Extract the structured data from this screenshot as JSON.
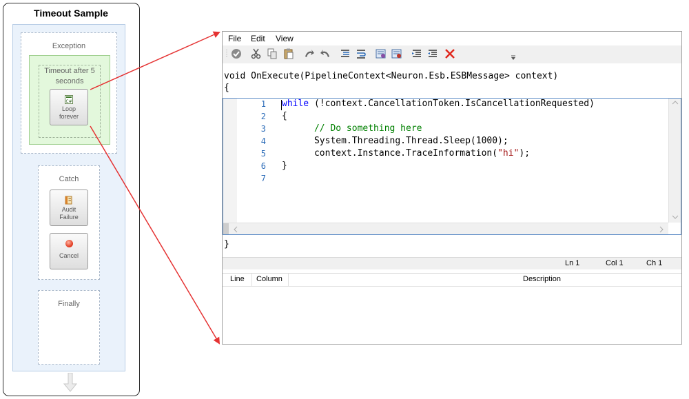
{
  "pipeline": {
    "title": "Timeout Sample",
    "exception_label": "Exception",
    "timeout_label": "Timeout after 5 seconds",
    "loop_step": "Loop forever",
    "catch_label": "Catch",
    "audit_step": "Audit Failure",
    "cancel_step": "Cancel",
    "finally_label": "Finally"
  },
  "editor": {
    "menu": [
      "File",
      "Edit",
      "View"
    ],
    "signature": "void OnExecute(PipelineContext<Neuron.Esb.ESBMessage> context)",
    "open_brace": "{",
    "close_brace": "}",
    "line_numbers": [
      "1",
      "2",
      "3",
      "4",
      "5",
      "6",
      "7"
    ],
    "code": {
      "l1_kw": "while",
      "l1_rest": " (!context.CancellationToken.IsCancellationRequested)",
      "l2": "{",
      "l3": "      // Do something here",
      "l4": "      System.Threading.Thread.Sleep(1000);",
      "l5_a": "      context.Instance.TraceInformation(",
      "l5_str": "\"hi\"",
      "l5_b": ");",
      "l6": "}",
      "l7": ""
    },
    "status": {
      "ln": "Ln 1",
      "col": "Col 1",
      "ch": "Ch 1"
    },
    "error_columns": {
      "line": "Line",
      "column": "Column",
      "description": "Description"
    }
  },
  "colors": {
    "arrow": "#e53333",
    "keyword": "#0000ff",
    "comment": "#008000",
    "string": "#a31515"
  },
  "toolbar_icons": [
    "check-icon",
    "cut-icon",
    "copy-icon",
    "paste-icon",
    "undo-icon",
    "redo-icon",
    "indent-icon",
    "outdent-icon",
    "bookmark-icon",
    "bookmark-next-icon",
    "comment-icon",
    "uncomment-icon",
    "delete-icon"
  ]
}
